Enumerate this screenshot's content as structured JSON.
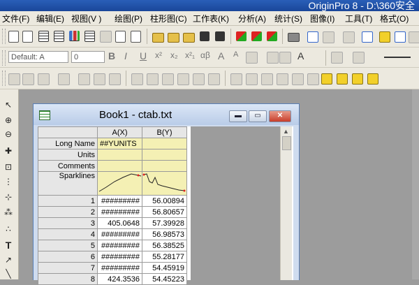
{
  "app": {
    "title": "OriginPro 8 - D:\\360安全"
  },
  "menu": [
    "文件(F)",
    "编辑(E)",
    "视图(V )",
    "绘图(P)",
    "柱形图(C)",
    "工作表(K)",
    "分析(A)",
    "统计(S)",
    "图像(I)",
    "工具(T)",
    "格式(O)"
  ],
  "format_toolbar": {
    "font": "Default: A",
    "size": "0",
    "bold": "B",
    "italic": "I",
    "underline": "U",
    "superscript": "x²",
    "subscript": "x₂",
    "sup_sub": "x²₁",
    "greek": "αβ",
    "grow": "A",
    "shrink": "A"
  },
  "left_tools": [
    "pointer-icon",
    "zoom-in-icon",
    "zoom-out-icon",
    "screen-reader-icon",
    "region-icon",
    "data-reader-icon",
    "scale-icon",
    "mask-icon",
    "text-icon",
    "arrow-icon",
    "line-icon"
  ],
  "book": {
    "title": "Book1 - ctab.txt",
    "columns": [
      "A(X)",
      "B(Y)"
    ],
    "meta_rows": [
      {
        "label": "Long Name",
        "a": "##YUNITS",
        "b": ""
      },
      {
        "label": "Units",
        "a": "",
        "b": ""
      },
      {
        "label": "Comments",
        "a": "",
        "b": ""
      },
      {
        "label": "Sparklines",
        "a": "",
        "b": ""
      }
    ],
    "rows": [
      {
        "n": "1",
        "a": "#########",
        "b": "56.00894"
      },
      {
        "n": "2",
        "a": "#########",
        "b": "56.80657"
      },
      {
        "n": "3",
        "a": "405.0648",
        "b": "57.39928"
      },
      {
        "n": "4",
        "a": "#########",
        "b": "56.98573"
      },
      {
        "n": "5",
        "a": "#########",
        "b": "56.38525"
      },
      {
        "n": "6",
        "a": "#########",
        "b": "55.28177"
      },
      {
        "n": "7",
        "a": "#########",
        "b": "54.45919"
      },
      {
        "n": "8",
        "a": "424.3536",
        "b": "54.45223"
      }
    ]
  }
}
